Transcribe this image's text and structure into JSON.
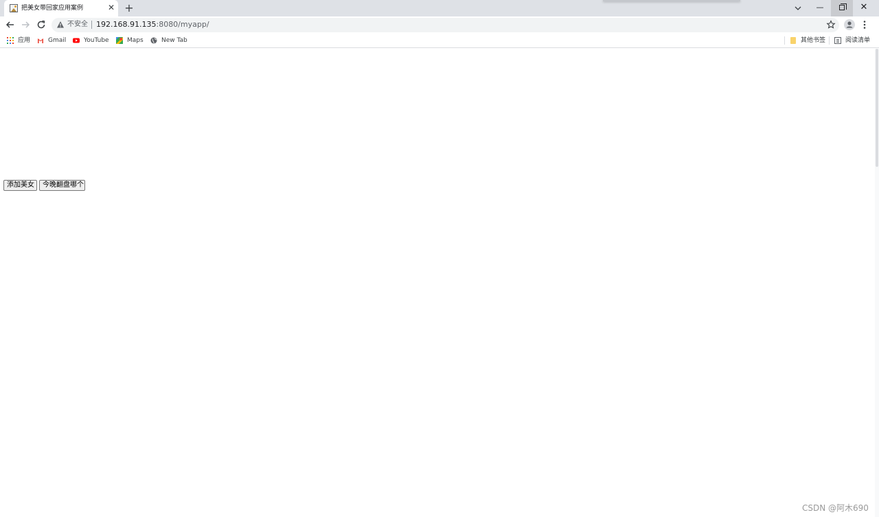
{
  "browser": {
    "tab": {
      "title": "把美女带回家应用案例",
      "close_glyph": "✕"
    },
    "new_tab_glyph": "+",
    "window_controls": {
      "minimize": "—",
      "close": "✕"
    }
  },
  "toolbar": {
    "insecure_label": "不安全",
    "url_host": "192.168.91.135",
    "url_rest": ":8080/myapp/"
  },
  "bookmarks": {
    "left": [
      {
        "label": "应用",
        "icon": "apps-grid-icon"
      },
      {
        "label": "Gmail",
        "icon": "gmail-icon"
      },
      {
        "label": "YouTube",
        "icon": "youtube-icon"
      },
      {
        "label": "Maps",
        "icon": "maps-icon"
      },
      {
        "label": "New Tab",
        "icon": "globe-icon"
      }
    ],
    "right": [
      {
        "label": "其他书签",
        "icon": "folder-icon"
      },
      {
        "label": "阅读清单",
        "icon": "reading-list-icon"
      }
    ]
  },
  "page": {
    "buttons": [
      {
        "label": "添加美女"
      },
      {
        "label": "今晚翻盘哪个"
      }
    ],
    "watermark": "CSDN @阿木690"
  },
  "colors": {
    "tabstrip": "#dee1e6",
    "omnibox": "#f1f3f4",
    "youtube_red": "#ff0000",
    "gmail_red": "#ea4335"
  }
}
